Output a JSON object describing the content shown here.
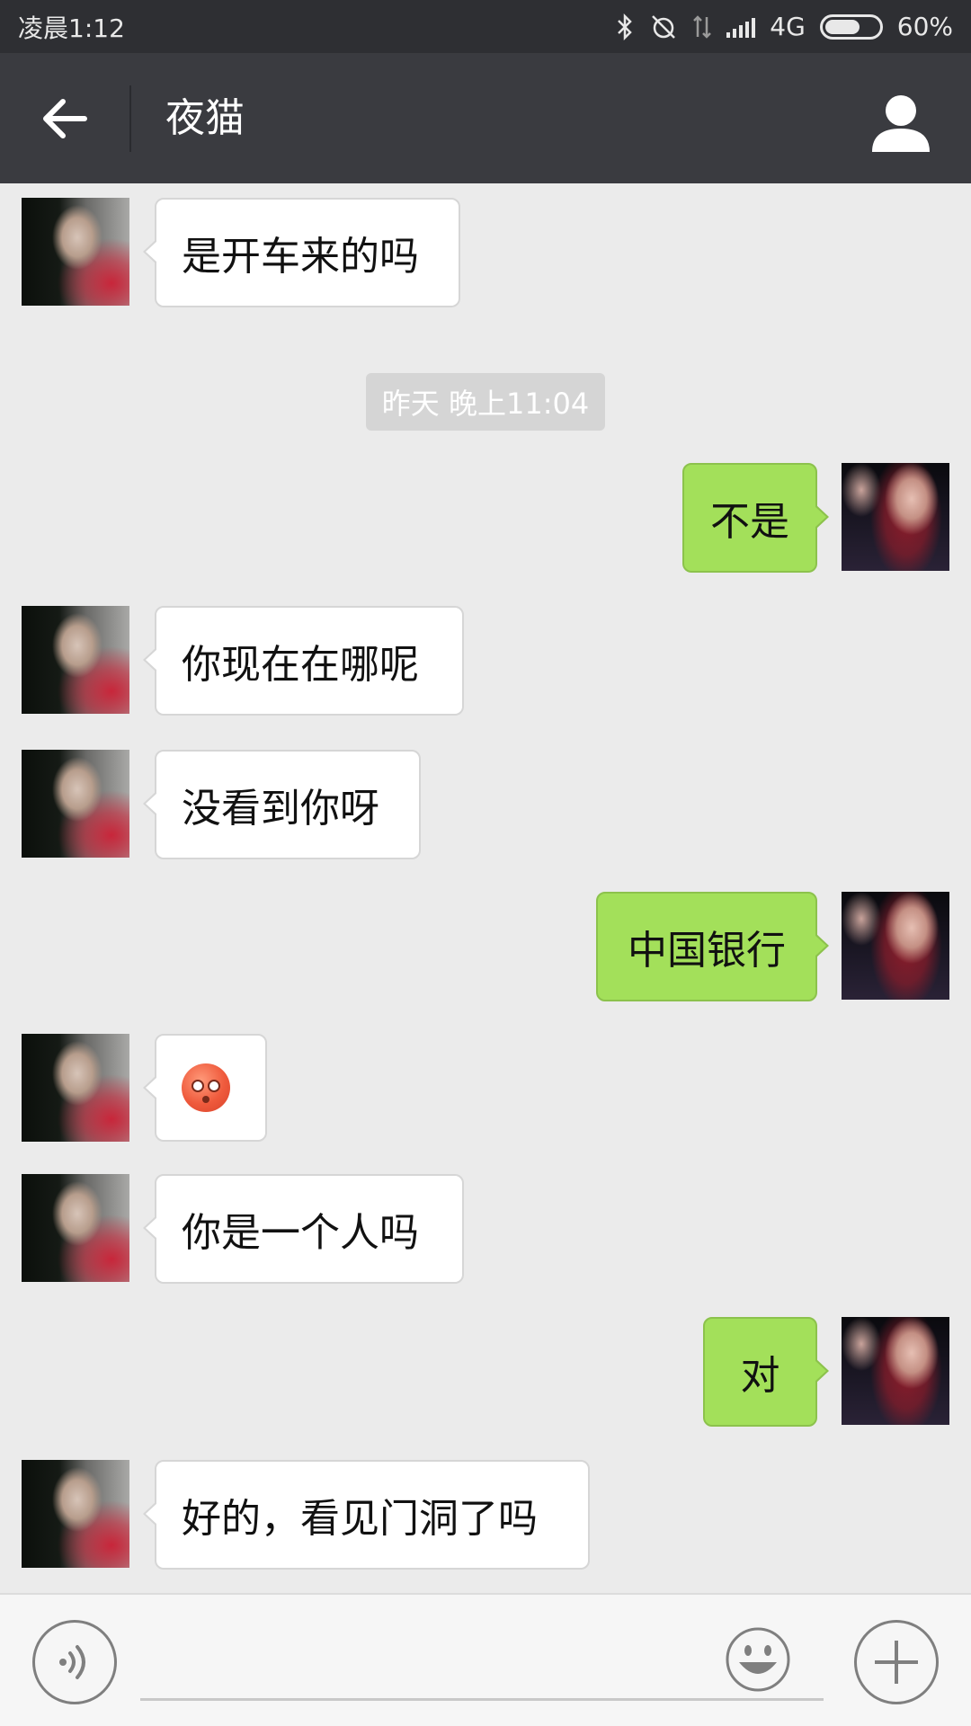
{
  "status_bar": {
    "time": "凌晨1:12",
    "network": "4G",
    "battery": "60%",
    "icons": [
      "bluetooth-icon",
      "alarm-off-icon",
      "data-arrows-icon",
      "signal-icon",
      "battery-icon"
    ]
  },
  "header": {
    "title": "夜猫",
    "icons": [
      "back-arrow-icon",
      "profile-icon"
    ]
  },
  "timestamp": "昨天 晚上11:04",
  "messages": [
    {
      "side": "in",
      "text": "是开车来的吗"
    },
    {
      "side": "out",
      "text": "不是"
    },
    {
      "side": "in",
      "text": "你现在在哪呢"
    },
    {
      "side": "in",
      "text": "没看到你呀"
    },
    {
      "side": "out",
      "text": "中国银行"
    },
    {
      "side": "in",
      "emoji": "flushed-face-emoji"
    },
    {
      "side": "in",
      "text": "你是一个人吗"
    },
    {
      "side": "out",
      "text": "对"
    },
    {
      "side": "in",
      "text": "好的，看见门洞了吗"
    }
  ],
  "input_bar": {
    "value": "",
    "icons": [
      "voice-icon",
      "emoji-icon",
      "plus-icon"
    ]
  },
  "colors": {
    "header_bg": "#3a3b40",
    "status_bg": "#2e2f33",
    "chat_bg": "#ebebeb",
    "outgoing_bubble": "#a3e05a",
    "incoming_bubble": "#ffffff"
  }
}
